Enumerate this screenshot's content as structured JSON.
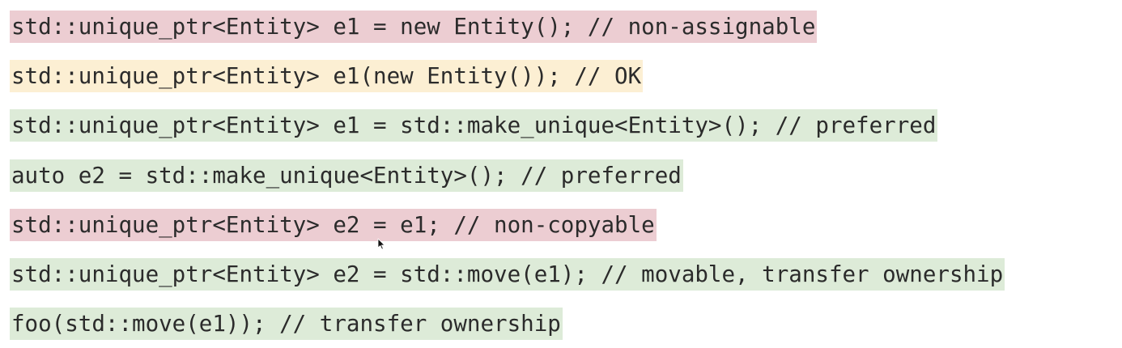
{
  "colors": {
    "bad": "#eccdd2",
    "warn": "#fcefd3",
    "good": "#ddebd8"
  },
  "lines": [
    {
      "text": "std::unique_ptr<Entity> e1 = new Entity(); // non-assignable",
      "status": "bad"
    },
    {
      "text": "std::unique_ptr<Entity> e1(new Entity()); // OK",
      "status": "warn"
    },
    {
      "text": "std::unique_ptr<Entity> e1 = std::make_unique<Entity>(); // preferred",
      "status": "good"
    },
    {
      "text": "auto e2 = std::make_unique<Entity>(); // preferred",
      "status": "good"
    },
    {
      "text": "std::unique_ptr<Entity> e2 = e1; // non-copyable",
      "status": "bad"
    },
    {
      "text": "std::unique_ptr<Entity> e2 = std::move(e1); // movable, transfer ownership",
      "status": "good"
    },
    {
      "text": "foo(std::move(e1)); // transfer ownership",
      "status": "good"
    }
  ],
  "cursor": {
    "icon": "mouse-pointer-icon"
  }
}
